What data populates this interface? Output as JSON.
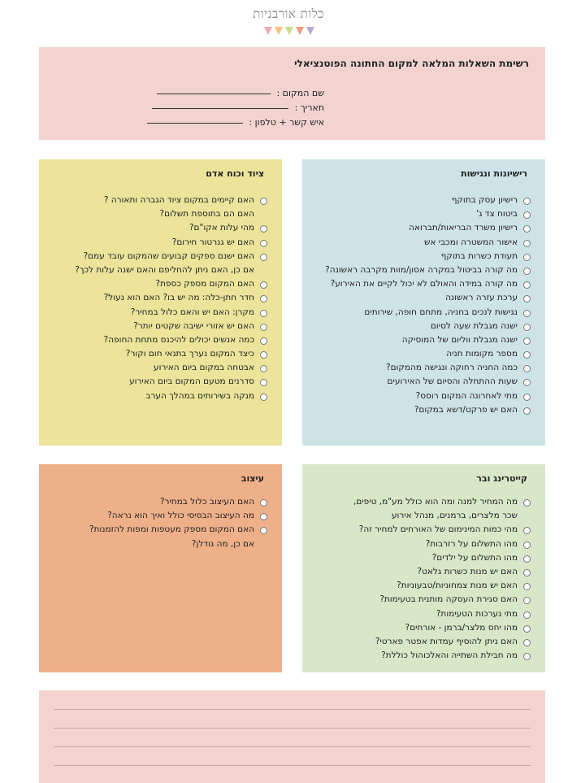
{
  "logo": {
    "text": "כלות אורבניות",
    "flag_colors": [
      "#f3a9b5",
      "#f2c27e",
      "#c9dc8d",
      "#f29c7c",
      "#b9a8d3"
    ]
  },
  "header": {
    "title": "רשימת השאלות המלאה למקום החתונה הפוטנציאלי",
    "fields": [
      {
        "label": "שם המקום :"
      },
      {
        "label": "תאריך :"
      },
      {
        "label": "איש קשר + טלפון :"
      }
    ]
  },
  "equipment": {
    "title": "ציוד וכוח אדם",
    "items": [
      {
        "text": "האם קיימים במקום ציוד הגברה ותאורה ?",
        "bullet": true
      },
      {
        "text": "האם הם בתוספת תשלום?",
        "bullet": false
      },
      {
        "text": "מהי עלות אקו\"ם?",
        "bullet": true
      },
      {
        "text": "האם יש גנרטור חירום?",
        "bullet": true
      },
      {
        "text": "האם ישנם ספקים קבועים שהמקום עובד עמם?",
        "bullet": true
      },
      {
        "text": "אם כן, האם ניתן להחליפם והאם ישנה עלות לכך?",
        "bullet": false
      },
      {
        "text": "האם המקום מספק כספת?",
        "bullet": true
      },
      {
        "text": "חדר חתן-כלה: מה יש בו? האם הוא נעול?",
        "bullet": true
      },
      {
        "text": "מקרן: האם יש והאם כלול במחיר?",
        "bullet": true
      },
      {
        "text": "האם יש אזורי ישיבה שקטים יותר?",
        "bullet": true
      },
      {
        "text": "כמה אנשים יכולים להיכנס מתחת החופה?",
        "bullet": true
      },
      {
        "text": "כיצד המקום נערך בתנאי חום וקור?",
        "bullet": true
      },
      {
        "text": "אבטחה במקום ביום האירוע",
        "bullet": true
      },
      {
        "text": "סדרנים מטעם המקום ביום האירוע",
        "bullet": true
      },
      {
        "text": "מנקה בשירותים במהלך הערב",
        "bullet": true
      }
    ]
  },
  "licenses": {
    "title": "רישיונות ונגישות",
    "items": [
      {
        "text": "רישיון עסק בתוקף",
        "bullet": true
      },
      {
        "text": "ביטוח צד ג'",
        "bullet": true
      },
      {
        "text": "רישיון משרד הבריאות/תברואה",
        "bullet": true
      },
      {
        "text": "אישור המשטרה ומכבי אש",
        "bullet": true
      },
      {
        "text": "תעודת כשרות בתוקף",
        "bullet": true
      },
      {
        "text": "מה קורה בביטול במקרה אסון/מוות מקרבה ראשונה?",
        "bullet": true
      },
      {
        "text": "מה קורה במידה והאולם לא יכול לקיים את האירוע?",
        "bullet": true
      },
      {
        "text": "ערכת עזרה ראשונה",
        "bullet": true
      },
      {
        "text": "נגישות לנכים בחניה, מתחם חופה, שירותים",
        "bullet": true
      },
      {
        "text": "ישנה מגבלת שעה לסיום",
        "bullet": true
      },
      {
        "text": "ישנה מגבלת ווליום של המוסיקה",
        "bullet": true
      },
      {
        "text": "מספר מקומות חניה",
        "bullet": true
      },
      {
        "text": "כמה החניה רחוקה ונגישה מהמקום?",
        "bullet": true
      },
      {
        "text": "שעות ההתחלה והסיום של האירועים",
        "bullet": true
      },
      {
        "text": "מתי לאחרונה המקום רוסס?",
        "bullet": true
      },
      {
        "text": "האם יש פרקט/דשא במקום?",
        "bullet": true
      }
    ]
  },
  "design": {
    "title": "עיצוב",
    "items": [
      {
        "text": "האם העיצוב כלול במחיר?",
        "bullet": true
      },
      {
        "text": "מה העיצוב הבסיסי כולל ואיך הוא נראה?",
        "bullet": true
      },
      {
        "text": "האם המקום מספק מעטפות ומפות להזמנות?",
        "bullet": true
      },
      {
        "text": "אם כן, מה גודלן?",
        "bullet": false
      }
    ]
  },
  "catering": {
    "title": "קייטרינג ובר",
    "items": [
      {
        "text": "מה המחיר למנה ומה הוא כולל מע\"מ, טיפים,",
        "bullet": true
      },
      {
        "text": "שכר מלצרים, ברמנים, מנהל אירוע",
        "bullet": false
      },
      {
        "text": "מהי כמות המינימום של האורחים למחיר זה?",
        "bullet": true
      },
      {
        "text": "מהו התשלום על רזרבות?",
        "bullet": true
      },
      {
        "text": "מהו התשלום על ילדים?",
        "bullet": true
      },
      {
        "text": "האם יש מנות כשרות גלאט?",
        "bullet": true
      },
      {
        "text": "האם יש מנות צמחוניות/טבעוניות?",
        "bullet": true
      },
      {
        "text": "האם סגירת העסקה מותנית בטעימות?",
        "bullet": true
      },
      {
        "text": "מתי נערכות הטעימות?",
        "bullet": true
      },
      {
        "text": "מהו יחס מלצר/ברמן - אורחים?",
        "bullet": true
      },
      {
        "text": "האם ניתן להוסיף עמדות אפטר פארטי?",
        "bullet": true
      },
      {
        "text": "מה חבילת השתייה והאלכוהול כוללת?",
        "bullet": true
      }
    ]
  },
  "colors": {
    "pink": "#f2d3d0",
    "yellow": "#ebe49a",
    "blue": "#cde3e8",
    "orange": "#eeb089",
    "green": "#d7e7c8"
  }
}
